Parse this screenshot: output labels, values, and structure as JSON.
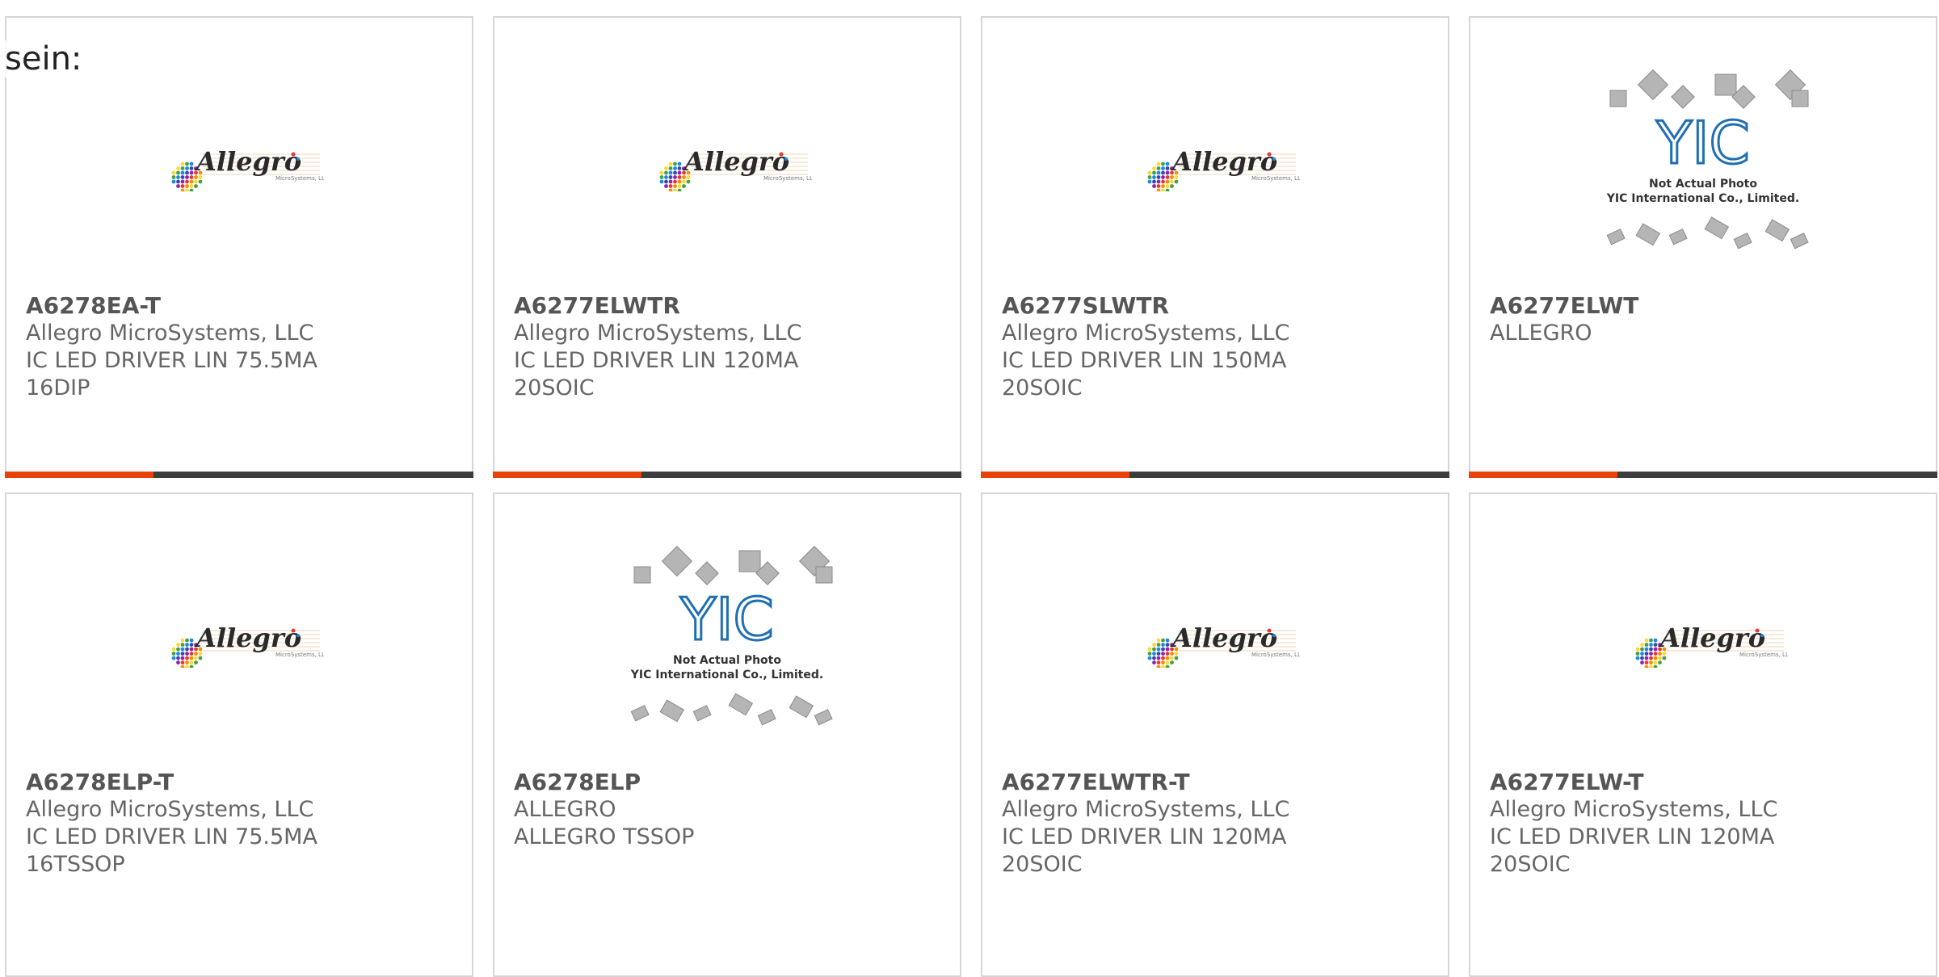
{
  "overlay_text": "sein:",
  "accent_color": "#e8410a",
  "cards": [
    {
      "part": "A6278EA-T",
      "mfr": "Allegro MicroSystems, LLC",
      "desc1": "IC LED DRIVER LIN 75.5MA",
      "desc2": "16DIP",
      "image": "allegro-logo"
    },
    {
      "part": "A6277ELWTR",
      "mfr": "Allegro MicroSystems, LLC",
      "desc1": "IC LED DRIVER LIN 120MA",
      "desc2": "20SOIC",
      "image": "allegro-logo"
    },
    {
      "part": "A6277SLWTR",
      "mfr": "Allegro MicroSystems, LLC",
      "desc1": "IC LED DRIVER LIN 150MA",
      "desc2": "20SOIC",
      "image": "allegro-logo"
    },
    {
      "part": "A6277ELWT",
      "mfr": "ALLEGRO",
      "desc1": "",
      "desc2": "",
      "image": "yic-placeholder"
    },
    {
      "part": "A6278ELP-T",
      "mfr": "Allegro MicroSystems, LLC",
      "desc1": "IC LED DRIVER LIN 75.5MA",
      "desc2": "16TSSOP",
      "image": "allegro-logo"
    },
    {
      "part": "A6278ELP",
      "mfr": "ALLEGRO",
      "desc1": "ALLEGRO TSSOP",
      "desc2": "",
      "image": "yic-placeholder"
    },
    {
      "part": "A6277ELWTR-T",
      "mfr": "Allegro MicroSystems, LLC",
      "desc1": "IC LED DRIVER LIN 120MA",
      "desc2": "20SOIC",
      "image": "allegro-logo"
    },
    {
      "part": "A6277ELW-T",
      "mfr": "Allegro MicroSystems, LLC",
      "desc1": "IC LED DRIVER LIN 120MA",
      "desc2": "20SOIC",
      "image": "allegro-logo"
    }
  ],
  "allegro_logo": {
    "wordmark": "Allegro",
    "sub": "MicroSystems, LLC"
  },
  "yic_placeholder": {
    "mark": "YIC",
    "line1": "Not Actual Photo",
    "line2": "YIC International Co., Limited."
  }
}
